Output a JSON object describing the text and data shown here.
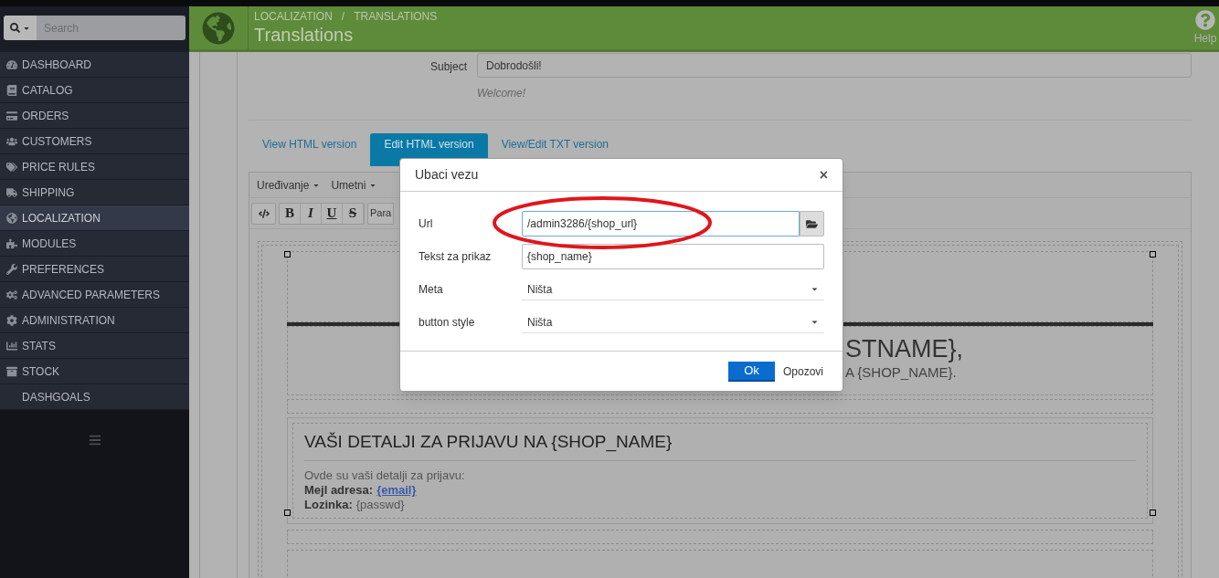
{
  "search": {
    "placeholder": "Search"
  },
  "sidebar": {
    "items": [
      {
        "label": "DASHBOARD",
        "selected": false
      },
      {
        "label": "CATALOG",
        "selected": false
      },
      {
        "label": "ORDERS",
        "selected": false
      },
      {
        "label": "CUSTOMERS",
        "selected": false
      },
      {
        "label": "PRICE RULES",
        "selected": false
      },
      {
        "label": "SHIPPING",
        "selected": false
      },
      {
        "label": "LOCALIZATION",
        "selected": true
      },
      {
        "label": "MODULES",
        "selected": false
      },
      {
        "label": "PREFERENCES",
        "selected": false
      },
      {
        "label": "ADVANCED PARAMETERS",
        "selected": false
      },
      {
        "label": "ADMINISTRATION",
        "selected": false
      },
      {
        "label": "STATS",
        "selected": false
      },
      {
        "label": "STOCK",
        "selected": false
      },
      {
        "label": "DASHGOALS",
        "selected": false
      }
    ]
  },
  "header": {
    "breadcrumb": [
      "LOCALIZATION",
      "TRANSLATIONS"
    ],
    "separator": "/",
    "title": "Translations",
    "help": "Help"
  },
  "form": {
    "subject_label": "Subject",
    "subject_value": "Dobrodošli!",
    "subject_hint": "Welcome!"
  },
  "tabs": [
    {
      "label": "View HTML version",
      "selected": false
    },
    {
      "label": "Edit HTML version",
      "selected": true
    },
    {
      "label": "View/Edit TXT version",
      "selected": false
    }
  ],
  "editor": {
    "menus": [
      "Uređivanje",
      "Umetni"
    ],
    "format_buttons": [
      "B",
      "I",
      "U",
      "S"
    ],
    "block_format": "Para",
    "heading_partial": "STNAME},",
    "subheading_partial": "A {SHOP_NAME}.",
    "section_title": "VAŠI DETALJI ZA PRIJAVU NA {SHOP_NAME}",
    "intro": "Ovde su vaši detalji za prijavu:",
    "lines": [
      {
        "label": "Mejl adresa:",
        "value": "{email}",
        "kind": "link"
      },
      {
        "label": "Lozinka:",
        "value": "{passwd}",
        "kind": "text"
      }
    ]
  },
  "dialog": {
    "title": "Ubaci vezu",
    "close": "×",
    "fields": [
      {
        "kind": "browse",
        "label": "Url",
        "value": "/admin3286/{shop_url}",
        "focused": true
      },
      {
        "kind": "text",
        "label": "Tekst za prikaz",
        "value": "{shop_name}",
        "focused": false
      },
      {
        "kind": "select",
        "label": "Meta",
        "value": "Ništa"
      },
      {
        "kind": "select",
        "label": "button style",
        "value": "Ništa"
      }
    ],
    "ok": "Ok",
    "cancel": "Opozovi"
  }
}
